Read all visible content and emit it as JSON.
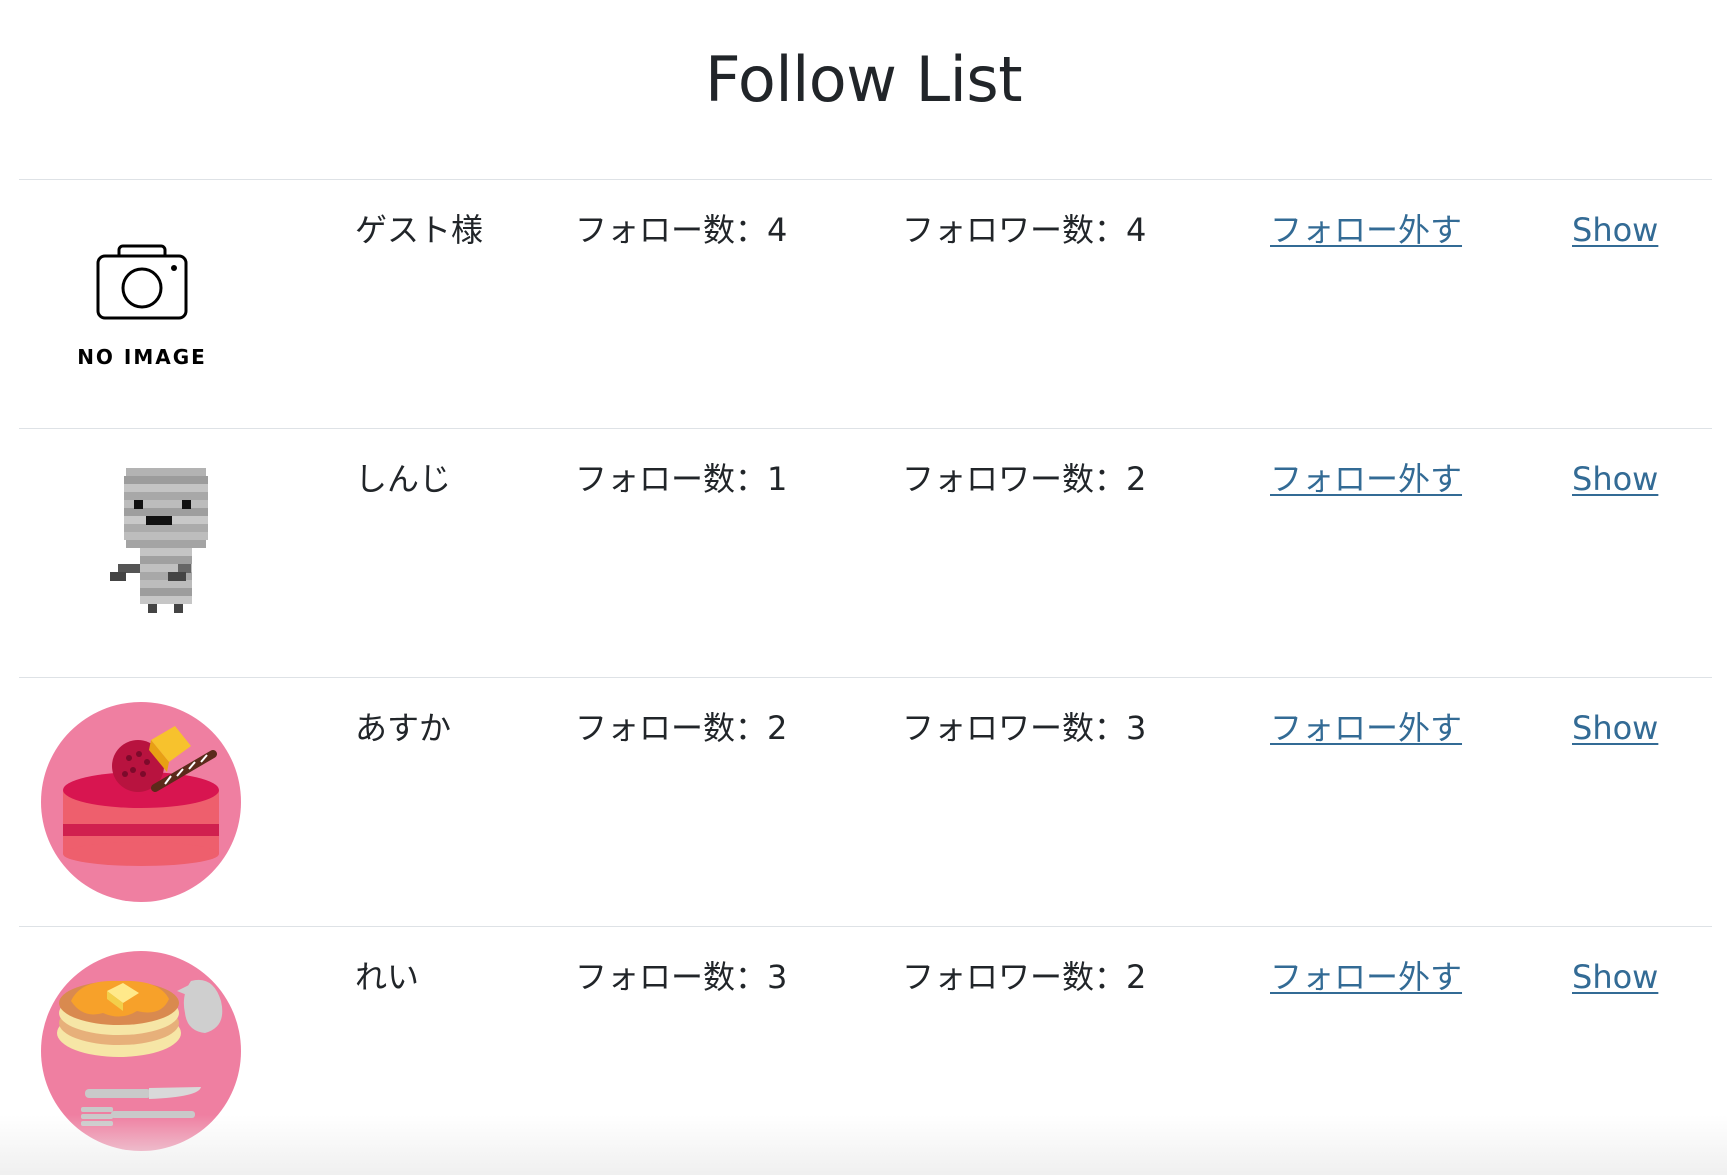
{
  "page": {
    "title": "Follow List"
  },
  "colors": {
    "link": "#336b95",
    "text": "#212529",
    "divider": "#dee2e6",
    "avatar_pink": "#ef7fa1"
  },
  "users": [
    {
      "name": "ゲスト様",
      "follow_count": "フォロー数：4",
      "follower_count": "フォロワー数：4",
      "unfollow_label": "フォロー外す",
      "show_label": "Show",
      "avatar": "no-image",
      "avatar_text": "NO IMAGE"
    },
    {
      "name": "しんじ",
      "follow_count": "フォロー数：1",
      "follower_count": "フォロワー数：2",
      "unfollow_label": "フォロー外す",
      "show_label": "Show",
      "avatar": "pixel-mummy"
    },
    {
      "name": "あすか",
      "follow_count": "フォロー数：2",
      "follower_count": "フォロワー数：3",
      "unfollow_label": "フォロー外す",
      "show_label": "Show",
      "avatar": "cake"
    },
    {
      "name": "れい",
      "follow_count": "フォロー数：3",
      "follower_count": "フォロワー数：2",
      "unfollow_label": "フォロー外す",
      "show_label": "Show",
      "avatar": "pancake"
    }
  ]
}
